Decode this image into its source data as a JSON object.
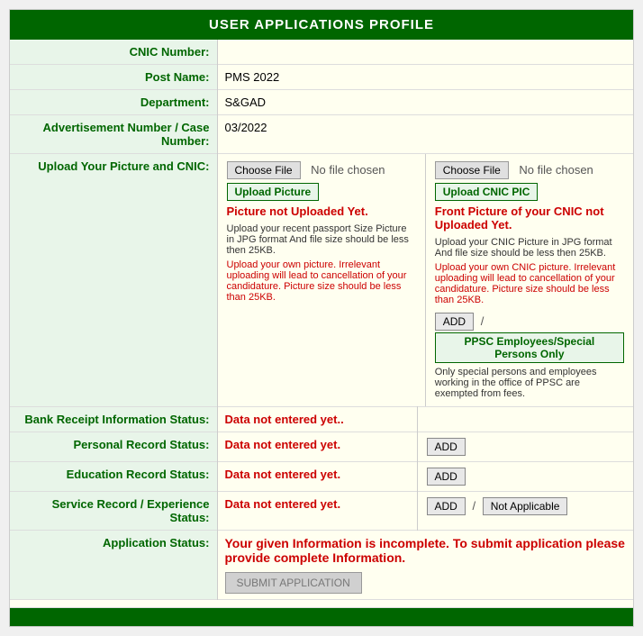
{
  "header": {
    "title": "USER APPLICATIONS PROFILE"
  },
  "fields": {
    "cnic_label": "CNIC Number:",
    "cnic_value": "",
    "post_label": "Post Name:",
    "post_value": "PMS 2022",
    "dept_label": "Department:",
    "dept_value": "S&GAD",
    "adv_label": "Advertisement Number / Case Number:",
    "adv_value": "03/2022"
  },
  "upload": {
    "section_label": "Upload Your Picture and CNIC:",
    "picture": {
      "choose_file": "Choose File",
      "no_file": "No file chosen",
      "upload_btn": "Upload Picture",
      "status": "Picture not Uploaded Yet.",
      "info_line1": "Upload your recent passport Size Picture in JPG format And file size should be less then 25KB.",
      "info_line2": "Upload your own picture. Irrelevant uploading will lead to cancellation of your candidature. Picture size should be less than 25KB."
    },
    "cnic": {
      "choose_file": "Choose File",
      "no_file": "No file chosen",
      "upload_btn": "Upload CNIC PIC",
      "status": "Front Picture of your CNIC not Uploaded Yet.",
      "info_line1": "Upload your CNIC Picture in JPG format And file size should be less then 25KB.",
      "info_line2": "Upload your own CNIC picture. Irrelevant uploading will lead to cancellation of your candidature. Picture size should be less than 25KB.",
      "add_btn": "ADD",
      "ppsc_btn": "PPSC Employees/Special Persons Only",
      "ppsc_info": "Only special persons and employees working in the office of PPSC are exempted from fees."
    }
  },
  "bank": {
    "label": "Bank Receipt Information Status:",
    "status": "Data not entered yet.."
  },
  "personal": {
    "label": "Personal Record Status:",
    "status": "Data not entered yet.",
    "add_btn": "ADD"
  },
  "education": {
    "label": "Education Record Status:",
    "status": "Data not entered yet.",
    "add_btn": "ADD"
  },
  "service": {
    "label": "Service Record / Experience Status:",
    "status": "Data not entered yet.",
    "add_btn": "ADD",
    "not_applicable_btn": "Not Applicable"
  },
  "application": {
    "label": "Application Status:",
    "status": "Your given Information is incomplete. To submit application please provide complete Information.",
    "submit_btn": "SUBMIT APPLICATION"
  }
}
